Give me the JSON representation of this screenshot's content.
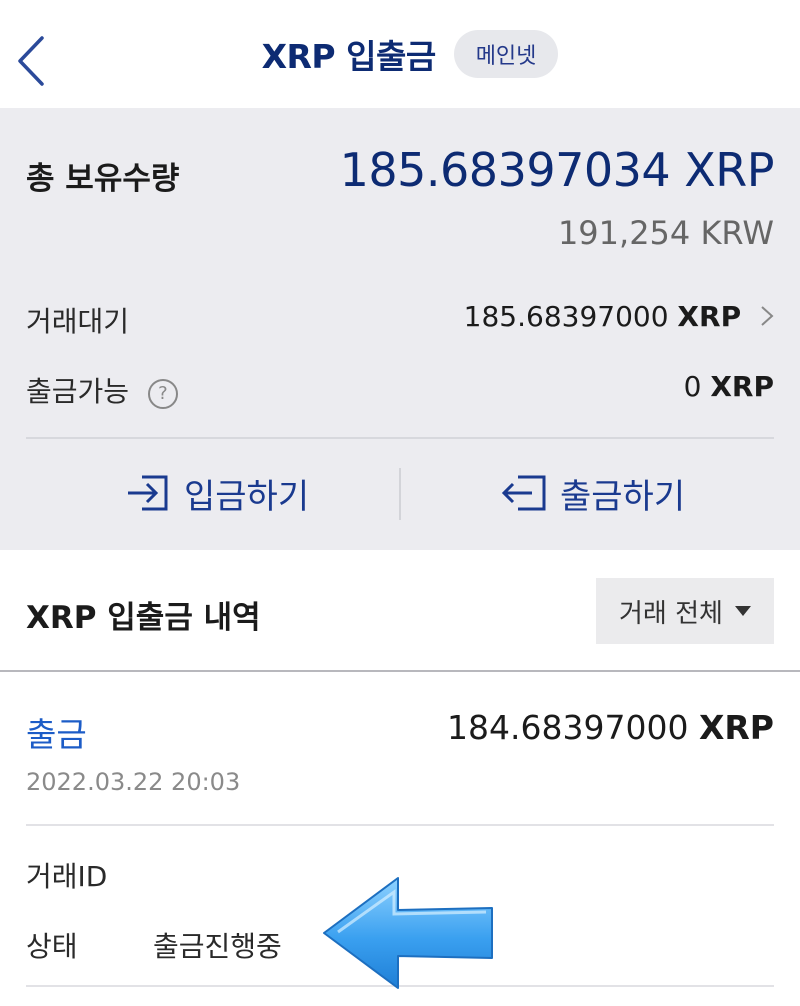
{
  "header": {
    "title": "XRP 입출금",
    "badge": "메인넷"
  },
  "summary": {
    "total_label": "총 보유수량",
    "total_amount": "185.68397034 XRP",
    "total_krw": "191,254 KRW",
    "pending_label": "거래대기",
    "pending_amount": "185.68397000",
    "pending_unit": "XRP",
    "available_label": "출금가능",
    "available_amount": "0",
    "available_unit": "XRP",
    "help_glyph": "?"
  },
  "actions": {
    "deposit_label": "입금하기",
    "withdraw_label": "출금하기"
  },
  "history": {
    "title": "XRP 입출금 내역",
    "filter_label": "거래 전체"
  },
  "transaction": {
    "type": "출금",
    "amount": "184.68397000",
    "unit": "XRP",
    "date": "2022.03.22 20:03",
    "id_label": "거래ID",
    "status_label": "상태",
    "status_value": "출금진행중"
  },
  "colors": {
    "brand": "#0d2b73",
    "accent_blue": "#1c5cc7",
    "summary_bg": "#ececf0",
    "arrow": "#3aa0f0"
  }
}
